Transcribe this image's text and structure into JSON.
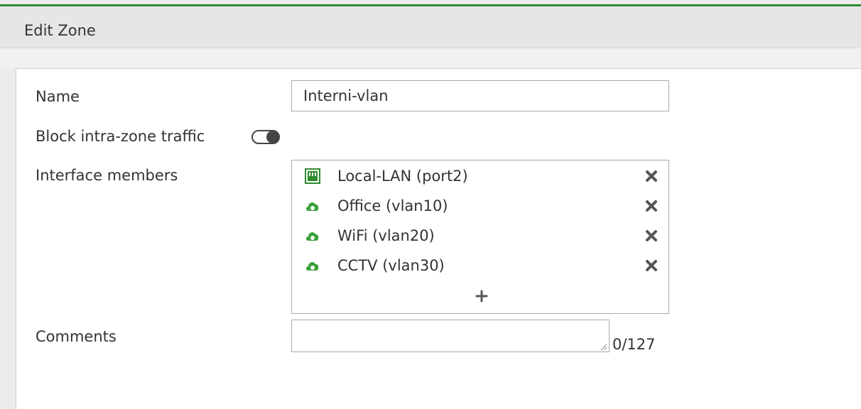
{
  "header": {
    "title": "Edit Zone"
  },
  "form": {
    "name_label": "Name",
    "name_value": "Interni-vlan",
    "block_label": "Block intra-zone traffic",
    "block_enabled": false,
    "members_label": "Interface members",
    "members": [
      {
        "label": "Local-LAN (port2)",
        "icon": "physical-port-icon"
      },
      {
        "label": "Office (vlan10)",
        "icon": "vlan-interface-icon"
      },
      {
        "label": "WiFi (vlan20)",
        "icon": "vlan-interface-icon"
      },
      {
        "label": "CCTV (vlan30)",
        "icon": "vlan-interface-icon"
      }
    ],
    "comments_label": "Comments",
    "comments_value": "",
    "comments_count": "0/127"
  },
  "colors": {
    "accent": "#2e8b2e",
    "icon_green": "#3aa03a",
    "text": "#333333"
  }
}
